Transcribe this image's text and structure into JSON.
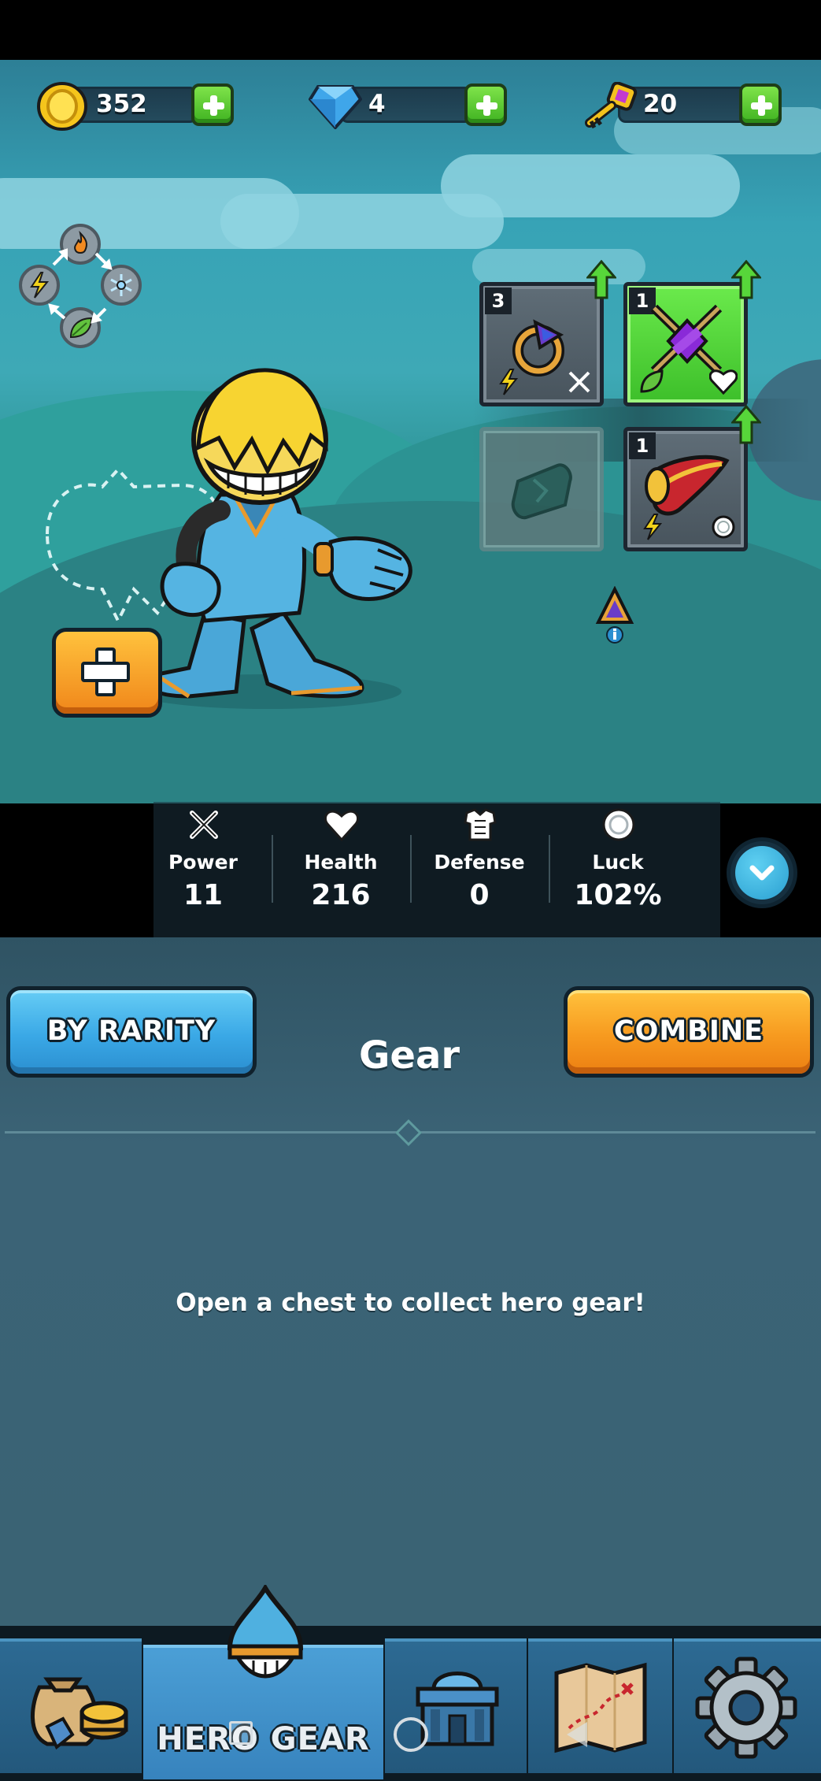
{
  "currency": {
    "coins": "352",
    "gems": "4",
    "keys": "20"
  },
  "gear_slots": [
    {
      "level": "3",
      "item": "ring-amulet",
      "stats": [
        "power",
        "lightning"
      ],
      "upgradable": true
    },
    {
      "level": "1",
      "item": "crossed-swords-gem",
      "stats": [
        "nature",
        "health"
      ],
      "upgradable": true,
      "highlighted": true
    },
    {
      "level": "",
      "item": "empty-slot",
      "stats": [],
      "upgradable": false
    },
    {
      "level": "1",
      "item": "horn",
      "stats": [
        "lightning",
        "luck"
      ],
      "upgradable": true
    }
  ],
  "stats": [
    {
      "label": "Power",
      "value": "11"
    },
    {
      "label": "Health",
      "value": "216"
    },
    {
      "label": "Defense",
      "value": "0"
    },
    {
      "label": "Luck",
      "value": "102%"
    }
  ],
  "buttons": {
    "by_rarity": "BY RARITY",
    "combine": "COMBINE"
  },
  "section_title": "Gear",
  "empty_message": "Open a chest to collect hero gear!",
  "nav": {
    "active_tab_label": "HERO GEAR",
    "tabs": [
      "loot-icon",
      "hero-gear-icon",
      "town-hall-icon",
      "treasure-map-icon",
      "settings-gear-icon"
    ]
  },
  "colors": {
    "plus_green": "#4cc22a",
    "rarity_blue": "#3aa8e6",
    "combine_orange": "#f79a1f",
    "slot_green": "#4fd23a"
  }
}
